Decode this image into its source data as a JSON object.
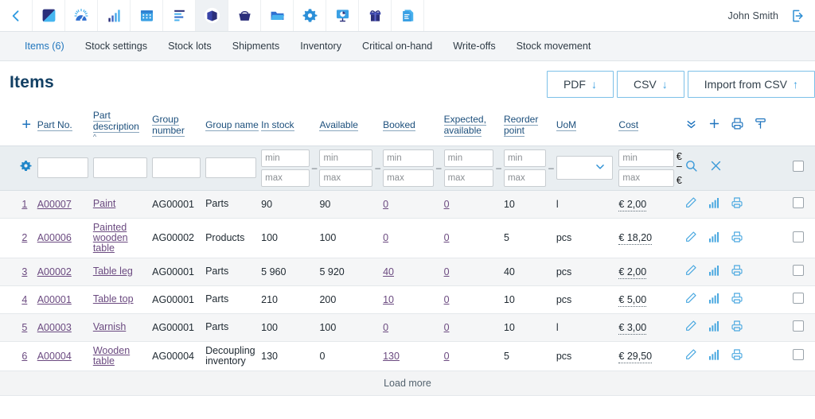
{
  "appbar": {
    "icons": [
      {
        "name": "back-chevron-icon",
        "label": "Back"
      },
      {
        "name": "dashboard-square-icon",
        "label": "Dashboard"
      },
      {
        "name": "gauge-icon",
        "label": "Performance"
      },
      {
        "name": "bar-chart-icon",
        "label": "Statistics"
      },
      {
        "name": "calendar-icon",
        "label": "Calendar"
      },
      {
        "name": "tasks-list-icon",
        "label": "Tasks"
      },
      {
        "name": "book-icon",
        "label": "Stock"
      },
      {
        "name": "basket-icon",
        "label": "Purchases"
      },
      {
        "name": "folder-icon",
        "label": "Documents"
      },
      {
        "name": "gear-icon",
        "label": "Settings"
      },
      {
        "name": "presentation-chart-icon",
        "label": "Reports"
      },
      {
        "name": "gift-icon",
        "label": "Products"
      },
      {
        "name": "document-icon",
        "label": "Invoices"
      }
    ],
    "active_index": 6,
    "user_name": "John Smith",
    "logout_label": "Log out"
  },
  "subnav": {
    "items": [
      {
        "label": "Items (6)",
        "active": true
      },
      {
        "label": "Stock settings",
        "active": false
      },
      {
        "label": "Stock lots",
        "active": false
      },
      {
        "label": "Shipments",
        "active": false
      },
      {
        "label": "Inventory",
        "active": false
      },
      {
        "label": "Critical on-hand",
        "active": false
      },
      {
        "label": "Write-offs",
        "active": false
      },
      {
        "label": "Stock movement",
        "active": false
      }
    ]
  },
  "page": {
    "title": "Items",
    "buttons": [
      {
        "label": "PDF",
        "arrow": "↓",
        "name": "pdf-export-button"
      },
      {
        "label": "CSV",
        "arrow": "↓",
        "name": "csv-export-button"
      },
      {
        "label": "Import from CSV",
        "arrow": "↑",
        "name": "import-from-csv-button"
      }
    ]
  },
  "table": {
    "headers": {
      "add": "+",
      "part_no": "Part No.",
      "part_description": "Part description",
      "part_description_sort": "^",
      "group_number": "Group number",
      "group_name": "Group name",
      "in_stock": "In stock",
      "available": "Available",
      "booked": "Booked",
      "expected_available": "Expected, available",
      "reorder_point": "Reorder point",
      "uom": "UoM",
      "cost": "Cost",
      "icons": [
        "chevrons-down-icon",
        "plus-icon",
        "printer-icon",
        "column-filter-icon"
      ]
    },
    "filters": {
      "gear_icon": "gear-icon",
      "part_no_value": "",
      "part_description_value": "",
      "group_number_value": "",
      "group_name_value": "",
      "min_placeholder": "min",
      "max_placeholder": "max",
      "dash": "–",
      "uom_selected": "",
      "currency_symbol": "€",
      "search_icon": "search-icon",
      "clear_icon": "clear-x-icon",
      "checkbox": false
    },
    "rows": [
      {
        "num": "1",
        "part_no": "A00007",
        "description": "Paint",
        "group_number": "AG00001",
        "group_name": "Parts",
        "in_stock": "90",
        "available": "90",
        "available_negative": false,
        "booked": "0",
        "expected_available": "0",
        "reorder_point": "10",
        "uom": "l",
        "cost": "€ 2,00"
      },
      {
        "num": "2",
        "part_no": "A00006",
        "description": "Painted wooden table",
        "group_number": "AG00002",
        "group_name": "Products",
        "in_stock": "100",
        "available": "100",
        "available_negative": false,
        "booked": "0",
        "expected_available": "0",
        "reorder_point": "5",
        "uom": "pcs",
        "cost": "€ 18,20"
      },
      {
        "num": "3",
        "part_no": "A00002",
        "description": "Table leg",
        "group_number": "AG00001",
        "group_name": "Parts",
        "in_stock": "5 960",
        "available": "5 920",
        "available_negative": false,
        "booked": "40",
        "expected_available": "0",
        "reorder_point": "40",
        "uom": "pcs",
        "cost": "€ 2,00"
      },
      {
        "num": "4",
        "part_no": "A00001",
        "description": "Table top",
        "group_number": "AG00001",
        "group_name": "Parts",
        "in_stock": "210",
        "available": "200",
        "available_negative": false,
        "booked": "10",
        "expected_available": "0",
        "reorder_point": "10",
        "uom": "pcs",
        "cost": "€ 5,00"
      },
      {
        "num": "5",
        "part_no": "A00003",
        "description": "Varnish",
        "group_number": "AG00001",
        "group_name": "Parts",
        "in_stock": "100",
        "available": "100",
        "available_negative": false,
        "booked": "0",
        "expected_available": "0",
        "reorder_point": "10",
        "uom": "l",
        "cost": "€ 3,00"
      },
      {
        "num": "6",
        "part_no": "A00004",
        "description": "Wooden table",
        "group_number": "AG00004",
        "group_name": "Decoupling inventory",
        "in_stock": "130",
        "available": "0",
        "available_negative": true,
        "booked": "130",
        "expected_available": "0",
        "reorder_point": "5",
        "uom": "pcs",
        "cost": "€ 29,50"
      }
    ],
    "row_icons": [
      "edit-pencil-icon",
      "stock-chart-icon",
      "print-label-icon"
    ],
    "load_more_label": "Load more"
  },
  "colors": {
    "accent_blue": "#2176bd",
    "link_purple": "#6b4a80",
    "negative_red": "#e0323c",
    "header_blue": "#123f63",
    "subnav_bg": "#f3f5f7",
    "filter_bg": "#e9eef1"
  }
}
